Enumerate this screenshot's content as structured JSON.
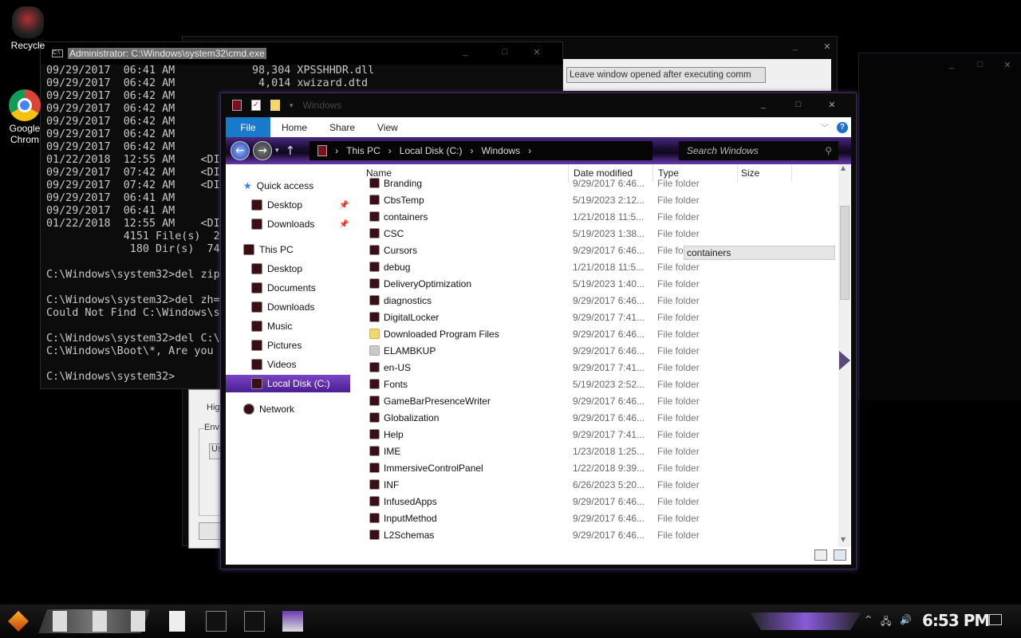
{
  "desktop": {
    "icons": [
      {
        "label": "Recycle"
      },
      {
        "label": "Google Chrom"
      }
    ]
  },
  "cmd": {
    "title": "Administrator: C:\\Windows\\system32\\cmd.exe",
    "lines": [
      "09/29/2017  06:41 AM            98,304 XPSSHHDR.dll",
      "09/29/2017  06:42 AM             4,014 xwizard.dtd",
      "09/29/2017  06:42 AM",
      "09/29/2017  06:42 AM",
      "09/29/2017  06:42 AM",
      "09/29/2017  06:42 AM",
      "09/29/2017  06:42 AM",
      "01/22/2018  12:55 AM    <DI",
      "09/29/2017  07:42 AM    <DI",
      "09/29/2017  07:42 AM    <DI",
      "09/29/2017  06:41 AM",
      "09/29/2017  06:41 AM",
      "01/22/2018  12:55 AM    <DI",
      "            4151 File(s)  2",
      "             180 Dir(s)  74",
      "",
      "C:\\Windows\\system32>del zip",
      "",
      "C:\\Windows\\system32>del zh=",
      "Could Not Find C:\\Windows\\s",
      "",
      "C:\\Windows\\system32>del C:\\",
      "C:\\Windows\\Boot\\*, Are you",
      "",
      "C:\\Windows\\system32>"
    ]
  },
  "dialog": {
    "button_label": "Leave window opened after executing comm"
  },
  "sysprops": {
    "hig": "Hig",
    "env": "Env",
    "us": "Us"
  },
  "explorer": {
    "title": "Windows",
    "ribbon": {
      "file": "File",
      "home": "Home",
      "share": "Share",
      "view": "View"
    },
    "address": [
      "This PC",
      "Local Disk (C:)",
      "Windows"
    ],
    "search_placeholder": "Search Windows",
    "nav": {
      "quick_access": "Quick access",
      "qa_desktop": "Desktop",
      "qa_downloads": "Downloads",
      "this_pc": "This PC",
      "desktop": "Desktop",
      "documents": "Documents",
      "downloads": "Downloads",
      "music": "Music",
      "pictures": "Pictures",
      "videos": "Videos",
      "local_disk": "Local Disk (C:)",
      "network": "Network"
    },
    "columns": {
      "name": "Name",
      "date": "Date modified",
      "type": "Type",
      "size": "Size"
    },
    "tooltip": "containers",
    "rows": [
      {
        "name": "Branding",
        "date": "9/29/2017 6:46...",
        "type": "File folder",
        "icon": "folder-dark"
      },
      {
        "name": "CbsTemp",
        "date": "5/19/2023 2:12...",
        "type": "File folder",
        "icon": "folder-dark"
      },
      {
        "name": "containers",
        "date": "1/21/2018 11:5...",
        "type": "File folder",
        "icon": "folder-dark"
      },
      {
        "name": "CSC",
        "date": "5/19/2023 1:38...",
        "type": "File folder",
        "icon": "folder-dark"
      },
      {
        "name": "Cursors",
        "date": "9/29/2017 6:46...",
        "type": "File fold",
        "icon": "folder-dark"
      },
      {
        "name": "debug",
        "date": "1/21/2018 11:5...",
        "type": "File folder",
        "icon": "folder-dark"
      },
      {
        "name": "DeliveryOptimization",
        "date": "5/19/2023 1:40...",
        "type": "File folder",
        "icon": "folder-dark"
      },
      {
        "name": "diagnostics",
        "date": "9/29/2017 6:46...",
        "type": "File folder",
        "icon": "folder-dark"
      },
      {
        "name": "DigitalLocker",
        "date": "9/29/2017 7:41...",
        "type": "File folder",
        "icon": "folder-dark"
      },
      {
        "name": "Downloaded Program Files",
        "date": "9/29/2017 6:46...",
        "type": "File folder",
        "icon": "folder-yellow"
      },
      {
        "name": "ELAMBKUP",
        "date": "9/29/2017 6:46...",
        "type": "File folder",
        "icon": "folder-gray"
      },
      {
        "name": "en-US",
        "date": "9/29/2017 7:41...",
        "type": "File folder",
        "icon": "folder-dark"
      },
      {
        "name": "Fonts",
        "date": "5/19/2023 2:52...",
        "type": "File folder",
        "icon": "folder-dark"
      },
      {
        "name": "GameBarPresenceWriter",
        "date": "9/29/2017 6:46...",
        "type": "File folder",
        "icon": "folder-dark"
      },
      {
        "name": "Globalization",
        "date": "9/29/2017 6:46...",
        "type": "File folder",
        "icon": "folder-dark"
      },
      {
        "name": "Help",
        "date": "9/29/2017 7:41...",
        "type": "File folder",
        "icon": "folder-dark"
      },
      {
        "name": "IME",
        "date": "1/23/2018 1:25...",
        "type": "File folder",
        "icon": "folder-dark"
      },
      {
        "name": "ImmersiveControlPanel",
        "date": "1/22/2018 9:39...",
        "type": "File folder",
        "icon": "folder-dark"
      },
      {
        "name": "INF",
        "date": "6/26/2023 5:20...",
        "type": "File folder",
        "icon": "folder-dark"
      },
      {
        "name": "InfusedApps",
        "date": "9/29/2017 6:46...",
        "type": "File folder",
        "icon": "folder-dark"
      },
      {
        "name": "InputMethod",
        "date": "9/29/2017 6:46...",
        "type": "File folder",
        "icon": "folder-dark"
      },
      {
        "name": "L2Schemas",
        "date": "9/29/2017 6:46...",
        "type": "File folder",
        "icon": "folder-dark"
      }
    ]
  },
  "taskbar": {
    "clock": "6:53 PM"
  },
  "colors": {
    "accent": "#7a44c8",
    "file_tab": "#1979ca"
  }
}
